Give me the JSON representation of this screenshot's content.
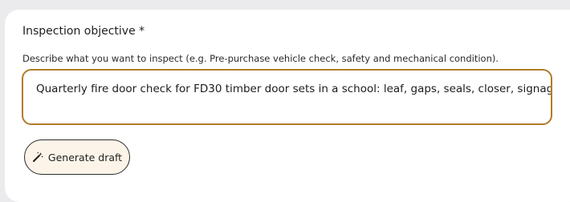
{
  "form": {
    "objective_label": "Inspection objective *",
    "objective_help": "Describe what you want to inspect (e.g. Pre-purchase vehicle check, safety and mechanical condition).",
    "objective_value": "Quarterly fire door check for FD30 timber door sets in a school: leaf, gaps, seals, closer, signage",
    "generate_button_label": "Generate draft",
    "generate_button_icon": "magic-wand-icon"
  },
  "colors": {
    "page_background": "#ebebee",
    "card_background": "#ffffff",
    "textarea_border": "#b07c2a",
    "button_background": "#fcf4e8",
    "button_border": "#2b2b2b"
  }
}
